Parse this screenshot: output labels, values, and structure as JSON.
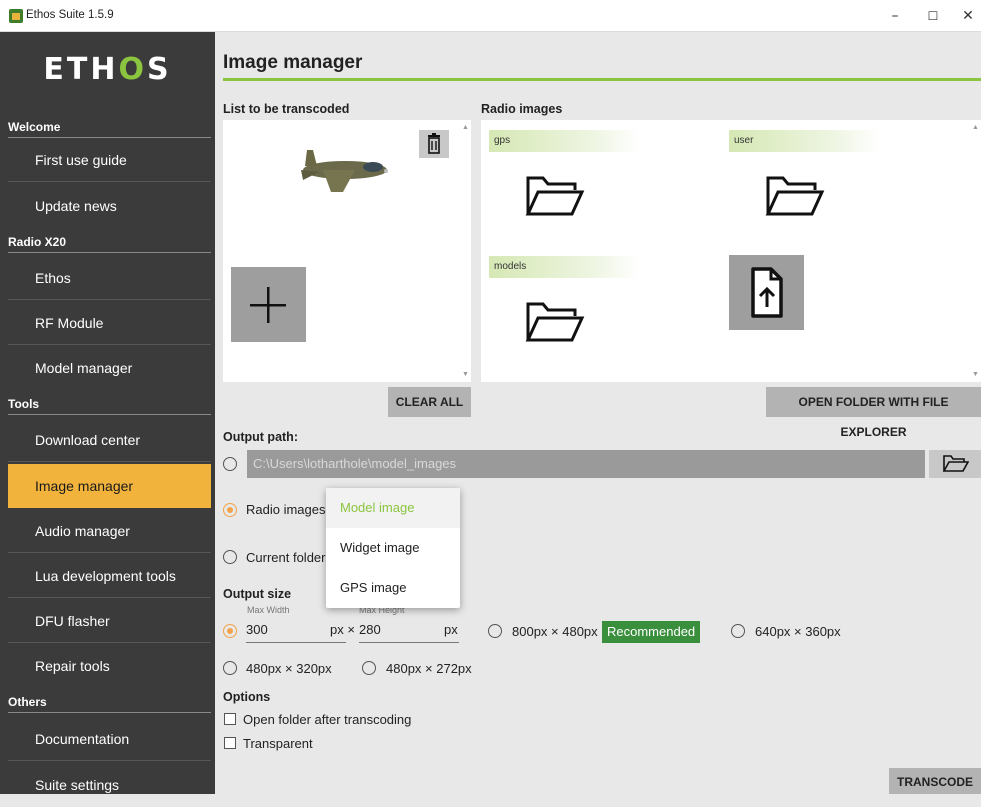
{
  "window": {
    "title": "Ethos Suite 1.5.9",
    "minimize": "–",
    "maximize": "☐",
    "close": "✕"
  },
  "sidebar": {
    "logo_left": "ETH",
    "logo_o": "O",
    "logo_right": "S",
    "sections": {
      "welcome": "Welcome",
      "radio": "Radio X20",
      "tools": "Tools",
      "others": "Others"
    },
    "items": {
      "first_use": "First use guide",
      "update_news": "Update news",
      "ethos": "Ethos",
      "rf_module": "RF Module",
      "model_manager": "Model manager",
      "download_center": "Download center",
      "image_manager": "Image manager",
      "audio_manager": "Audio manager",
      "lua_tools": "Lua development tools",
      "dfu_flasher": "DFU flasher",
      "repair_tools": "Repair tools",
      "documentation": "Documentation",
      "suite_settings": "Suite settings"
    },
    "active": "image_manager"
  },
  "main": {
    "title": "Image manager",
    "list_label": "List to be transcoded",
    "radio_images_label": "Radio images",
    "folders": [
      "gps",
      "user",
      "models"
    ],
    "clear_all": "CLEAR ALL",
    "open_folder": "OPEN FOLDER WITH FILE EXPLORER",
    "output_path_label": "Output path:",
    "output_path_value": "C:\\Users\\lotharthole\\model_images",
    "radio_images_option": "Radio images",
    "current_folder_option": "Current folder",
    "dropdown": {
      "options": [
        "Model image",
        "Widget image",
        "GPS image"
      ],
      "selected": "Model image"
    },
    "output_size_label": "Output size",
    "max_width_label": "Max Width",
    "max_height_label": "Max Height",
    "width_value": "300",
    "height_value": "280",
    "px_x": "px ×",
    "px": "px",
    "size_800": "800px × 480px",
    "recommended": "Recommended",
    "size_640": "640px × 360px",
    "size_480_320": "480px × 320px",
    "size_480_272": "480px × 272px",
    "options_label": "Options",
    "open_after": "Open folder after transcoding",
    "transparent": "Transparent",
    "transcode": "TRANSCODE"
  },
  "colors": {
    "accent_green": "#8bc53f",
    "active_orange": "#f2b33d",
    "radio_orange": "#f2a24a",
    "badge_green": "#3a8f3c",
    "sidebar_bg": "#3b3b3b"
  }
}
